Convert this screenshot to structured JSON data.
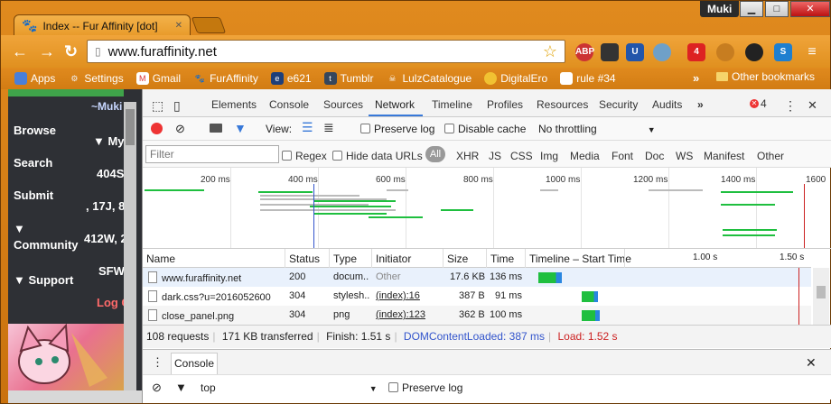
{
  "browser": {
    "tab_title": "Index -- Fur Affinity [dot]",
    "user": "Muki",
    "url": "www.furaffinity.net",
    "window_min": "▁",
    "window_max": "□",
    "window_close": "✕"
  },
  "bookmarks": {
    "items": [
      "Apps",
      "Settings",
      "Gmail",
      "FurAffinity",
      "e621",
      "Tumblr",
      "LulzCatalogue",
      "DigitalEro",
      "rule #34"
    ],
    "more": "»",
    "other": "Other bookmarks"
  },
  "extensions": [
    "ABP",
    "",
    "U",
    "",
    "4",
    "",
    "",
    "",
    "S",
    "≡"
  ],
  "page": {
    "nav": [
      "Browse",
      "Search",
      "Submit",
      "▼ Community",
      "▼ Support"
    ],
    "right": [
      "~Muki",
      "▼ My",
      "404S",
      ", 17J, 8",
      "412W, 2",
      "SFW",
      "Log C"
    ]
  },
  "devtools": {
    "tabs": [
      "Elements",
      "Console",
      "Sources",
      "Network",
      "Timeline",
      "Profiles",
      "Resources",
      "Security",
      "Audits"
    ],
    "error_count": "4",
    "toolbar": {
      "view_label": "View:",
      "preserve_log": "Preserve log",
      "disable_cache": "Disable cache",
      "throttle": "No throttling"
    },
    "filter": {
      "placeholder": "Filter",
      "regex": "Regex",
      "hide_data_urls": "Hide data URLs",
      "types": [
        "All",
        "XHR",
        "JS",
        "CSS",
        "Img",
        "Media",
        "Font",
        "Doc",
        "WS",
        "Manifest",
        "Other"
      ]
    },
    "overview_ticks": [
      "200 ms",
      "400 ms",
      "600 ms",
      "800 ms",
      "1000 ms",
      "1200 ms",
      "1400 ms",
      "1600"
    ],
    "columns": [
      "Name",
      "Status",
      "Type",
      "Initiator",
      "Size",
      "Time",
      "Timeline – Start Time"
    ],
    "waterfall_ticks": [
      "1.00 s",
      "1.50 s"
    ],
    "rows": [
      {
        "name": "www.furaffinity.net",
        "status": "200",
        "type": "docum...",
        "initiator": "Other",
        "size": "17.6 KB",
        "time": "136 ms",
        "start": 0.0,
        "duration": 0.13
      },
      {
        "name": "dark.css?u=2016052600",
        "status": "304",
        "type": "stylesh...",
        "initiator": "(index):16",
        "size": "387 B",
        "time": "91 ms",
        "start": 0.24,
        "duration": 0.09
      },
      {
        "name": "close_panel.png",
        "status": "304",
        "type": "png",
        "initiator": "(index):123",
        "size": "362 B",
        "time": "100 ms",
        "start": 0.24,
        "duration": 0.1
      }
    ],
    "summary": {
      "requests": "108 requests",
      "transferred": "171 KB transferred",
      "finish": "Finish: 1.51 s",
      "dcl": "DOMContentLoaded: 387 ms",
      "load": "Load: 1.52 s"
    },
    "drawer": {
      "tab": "Console",
      "context": "top",
      "preserve_log": "Preserve log"
    },
    "colors": {
      "accent": "#3879d9",
      "dcl": "#3355cc",
      "load": "#cc2222",
      "bar_green": "#1fbf3f",
      "bar_blue": "#2a86e0"
    }
  }
}
